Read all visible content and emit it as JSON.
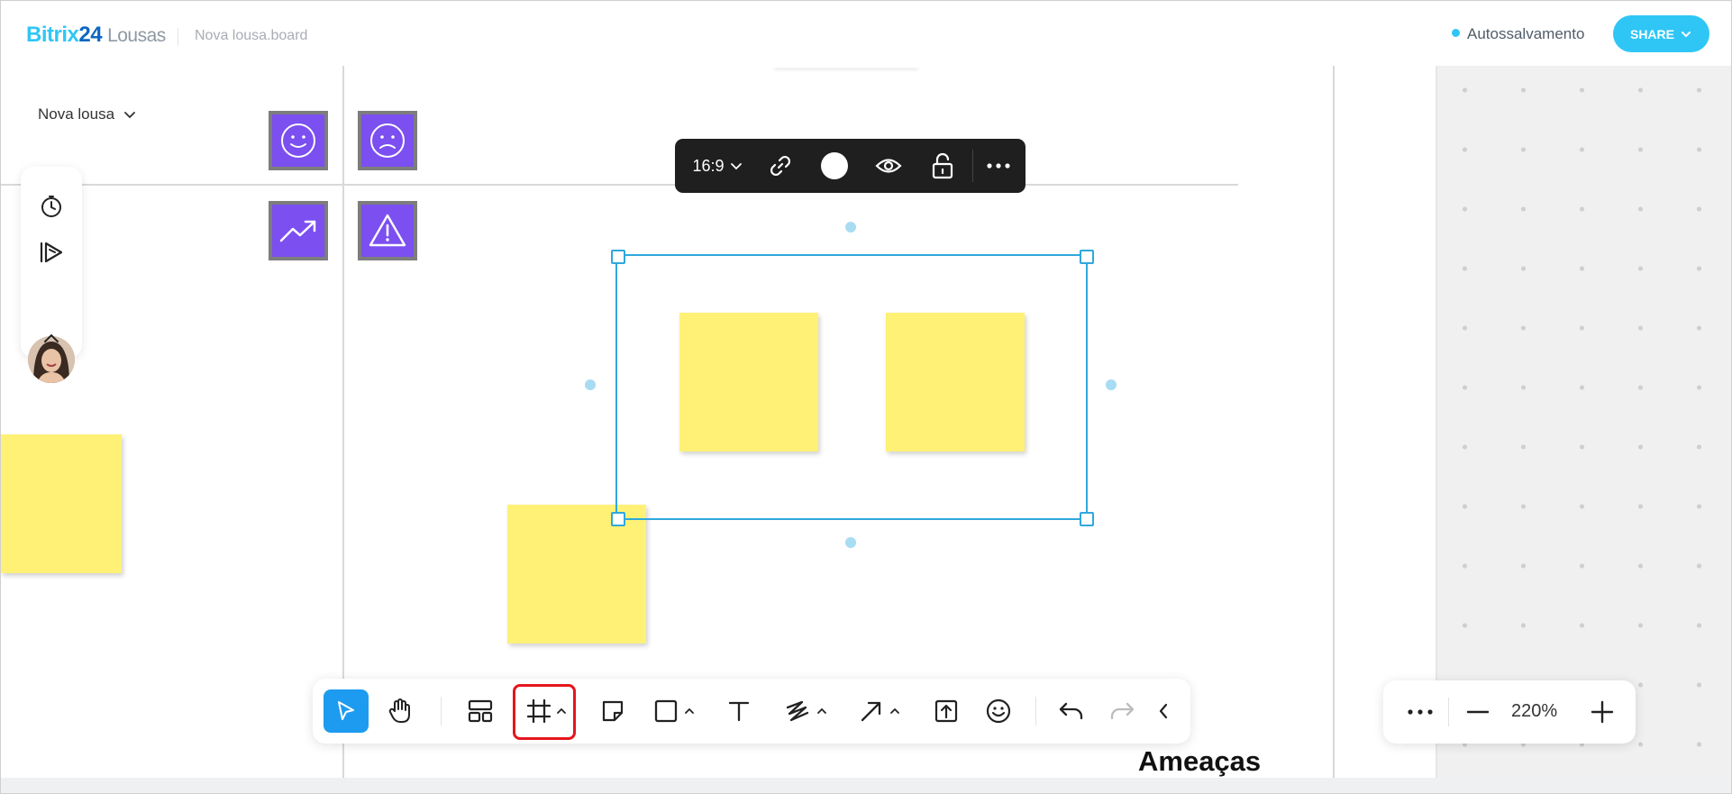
{
  "header": {
    "logo_part1": "Bitrix",
    "logo_part2": "24",
    "logo_part3": "Lousas",
    "filename": "Nova lousa.board",
    "autosave_label": "Autossalvamento",
    "share_label": "SHARE"
  },
  "board": {
    "name": "Nova lousa",
    "frame_label": "Ameaças"
  },
  "context_toolbar": {
    "aspect_ratio": "16:9",
    "color": "#ffffff"
  },
  "zoom": {
    "level": "220%"
  },
  "colors": {
    "accent": "#2fc6f6",
    "sticky": "#fff176",
    "tile": "#7b4ff0",
    "highlight": "#e4161c",
    "selection": "#2fa8dc"
  },
  "icons": {
    "left_panel": [
      "timer-icon",
      "presentation-icon",
      "avatar",
      "chevron-up-icon"
    ],
    "tiles": [
      "smile-icon",
      "sad-icon",
      "trend-up-icon",
      "warning-icon"
    ],
    "main_toolbar": [
      "select-icon",
      "hand-icon",
      "templates-icon",
      "frame-icon",
      "sticky-note-icon",
      "shape-icon",
      "text-icon",
      "pen-icon",
      "arrow-icon",
      "upload-icon",
      "emoji-icon",
      "undo-icon",
      "redo-icon",
      "collapse-icon"
    ],
    "zoom_panel": [
      "more-icon",
      "minus-icon",
      "plus-icon"
    ]
  }
}
